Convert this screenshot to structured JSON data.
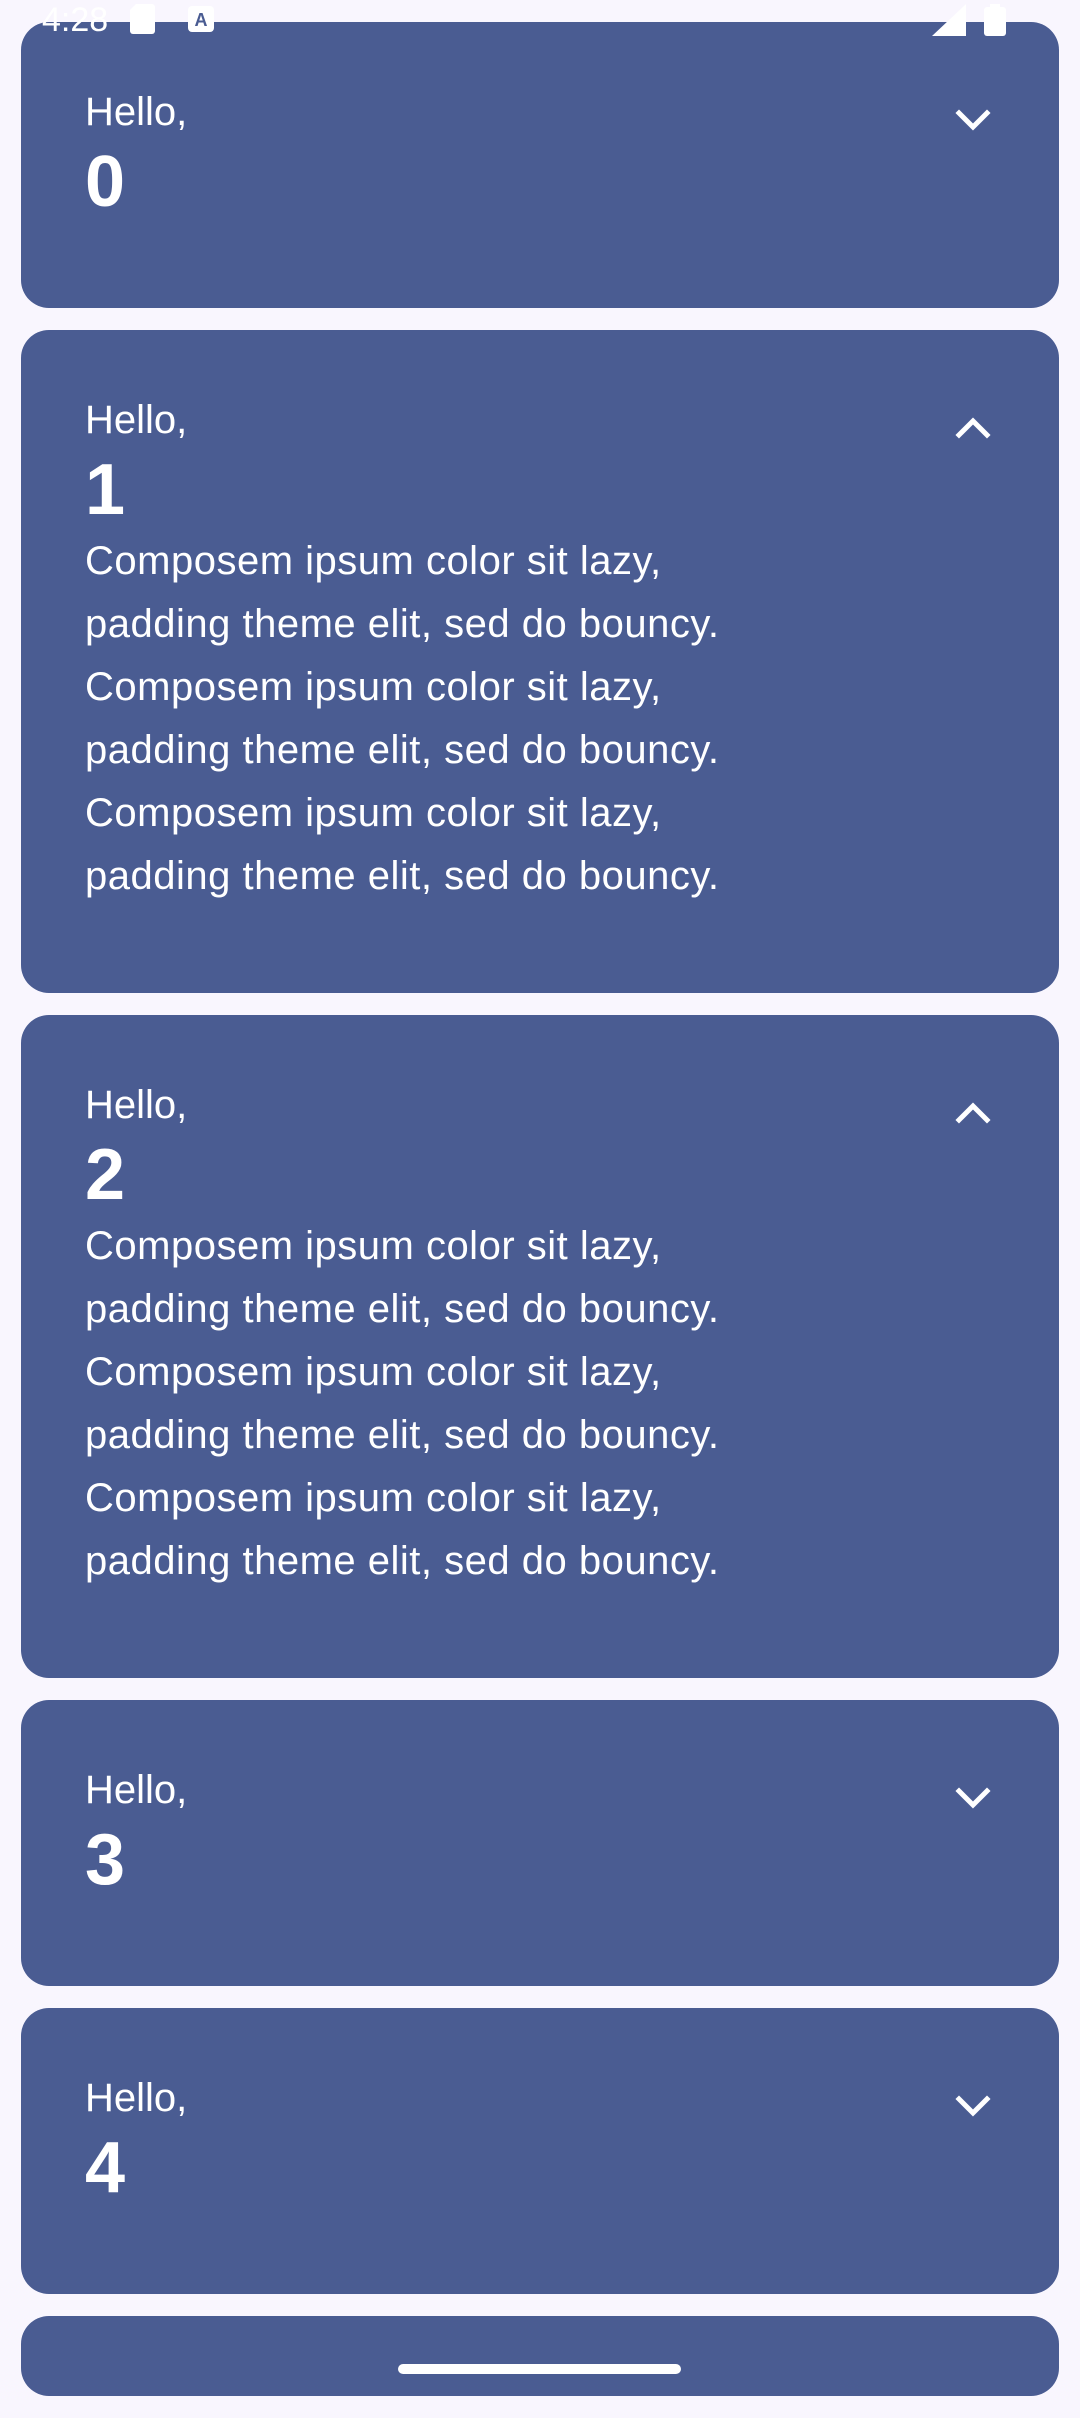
{
  "status_bar": {
    "time": "4:28",
    "icons": [
      "sd-card-icon",
      "keyboard-a-icon",
      "signal-icon",
      "battery-icon"
    ]
  },
  "colors": {
    "card": "#4A5C92",
    "background": "#F9F6FE",
    "text": "#FFFFFF"
  },
  "cards": [
    {
      "greeting": "Hello,",
      "number": "0",
      "expanded": false,
      "toggle_icon": "chevron-down-icon"
    },
    {
      "greeting": "Hello,",
      "number": "1",
      "expanded": true,
      "toggle_icon": "chevron-up-icon",
      "body_lines": [
        "Composem ipsum color sit lazy,",
        "padding theme elit, sed do bouncy.",
        "Composem ipsum color sit lazy,",
        "padding theme elit, sed do bouncy.",
        "Composem ipsum color sit lazy,",
        "padding theme elit, sed do bouncy."
      ]
    },
    {
      "greeting": "Hello,",
      "number": "2",
      "expanded": true,
      "toggle_icon": "chevron-up-icon",
      "body_lines": [
        "Composem ipsum color sit lazy,",
        "padding theme elit, sed do bouncy.",
        "Composem ipsum color sit lazy,",
        "padding theme elit, sed do bouncy.",
        "Composem ipsum color sit lazy,",
        "padding theme elit, sed do bouncy."
      ]
    },
    {
      "greeting": "Hello,",
      "number": "3",
      "expanded": false,
      "toggle_icon": "chevron-down-icon"
    },
    {
      "greeting": "Hello,",
      "number": "4",
      "expanded": false,
      "toggle_icon": "chevron-down-icon"
    }
  ]
}
